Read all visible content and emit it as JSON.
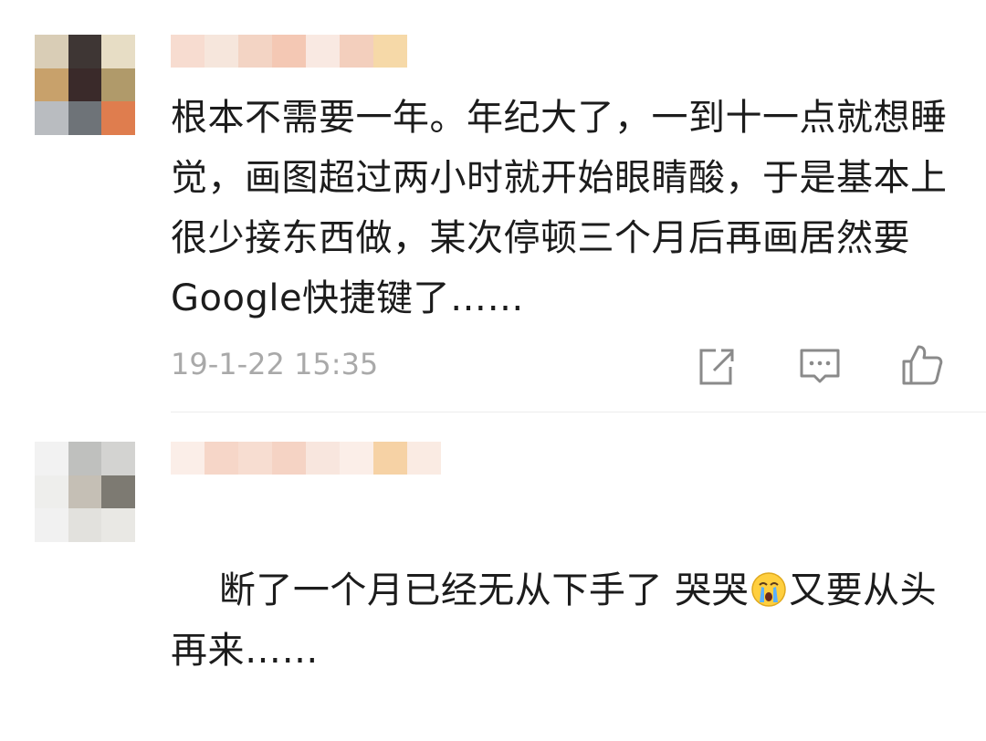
{
  "comments": [
    {
      "text": "根本不需要一年。年纪大了，一到十一点就想睡觉，画图超过两小时就开始眼睛酸，于是基本上很少接东西做，某次停顿三个月后再画居然要Google快捷键了……",
      "timestamp": "19-1-22 15:35",
      "actions": [
        "share-icon",
        "reply-icon",
        "like-icon"
      ]
    },
    {
      "text_before_emoji": "断了一个月已经无从下手了 哭哭",
      "emoji": "crying-face-icon",
      "text_after_emoji": "又要从头再来……"
    }
  ],
  "colors": {
    "text": "#1c1c1c",
    "meta": "#a9a9a9",
    "icon": "#8a8a8a",
    "divider": "#ececec"
  }
}
